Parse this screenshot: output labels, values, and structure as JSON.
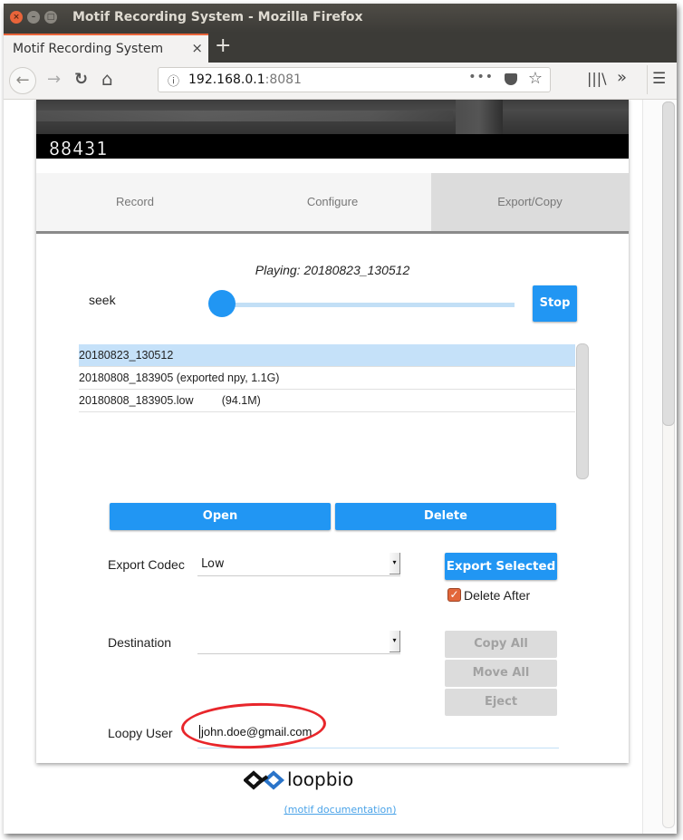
{
  "window": {
    "title": "Motif Recording System - Mozilla Firefox",
    "controls": {
      "close": "×",
      "minimize": "–",
      "maximize": "□"
    }
  },
  "browser": {
    "tab_title": "Motif Recording System",
    "tab_close": "×",
    "new_tab": "+",
    "url_host": "192.168.0.1",
    "url_port": ":8081",
    "icons": {
      "back": "←",
      "forward": "→",
      "reload": "↻",
      "home": "⌂",
      "info": "ⓘ",
      "more": "•••",
      "star": "☆",
      "library": "|||\\",
      "overflow": "»",
      "menu": "☰"
    }
  },
  "video": {
    "frame_counter": "88431"
  },
  "tabs": [
    {
      "label": "Record",
      "active": false
    },
    {
      "label": "Configure",
      "active": false
    },
    {
      "label": "Export/Copy",
      "active": true
    }
  ],
  "player": {
    "playing_text": "Playing: 20180823_130512",
    "seek_label": "seek",
    "seek_position": 0,
    "stop_label": "Stop"
  },
  "files": [
    {
      "name": "20180823_130512",
      "selected": true
    },
    {
      "name": "20180808_183905 (exported npy, 1.1G)",
      "selected": false
    },
    {
      "name": "20180808_183905.low         (94.1M)",
      "selected": false
    }
  ],
  "actions": {
    "open_label": "Open",
    "delete_label": "Delete"
  },
  "export": {
    "codec_label": "Export Codec",
    "codec_value": "Low",
    "export_selected_label": "Export Selected",
    "delete_after_label": "Delete After",
    "delete_after_checked": true,
    "checkbox_glyph": "✓"
  },
  "destination": {
    "label": "Destination",
    "value": "",
    "arrow_glyph": "▾",
    "copy_all_label": "Copy All",
    "move_all_label": "Move All",
    "eject_label": "Eject"
  },
  "loopy": {
    "label": "Loopy User",
    "value": "john.doe@gmail.com"
  },
  "footer": {
    "brand": "loopbio",
    "doc_link": "(motif documentation)"
  },
  "colors": {
    "accent": "#2196f3",
    "selected_row": "#c5e1f9",
    "annotation": "#e8262b",
    "checkbox": "#e2663a",
    "tab_accent": "#e9643a"
  }
}
